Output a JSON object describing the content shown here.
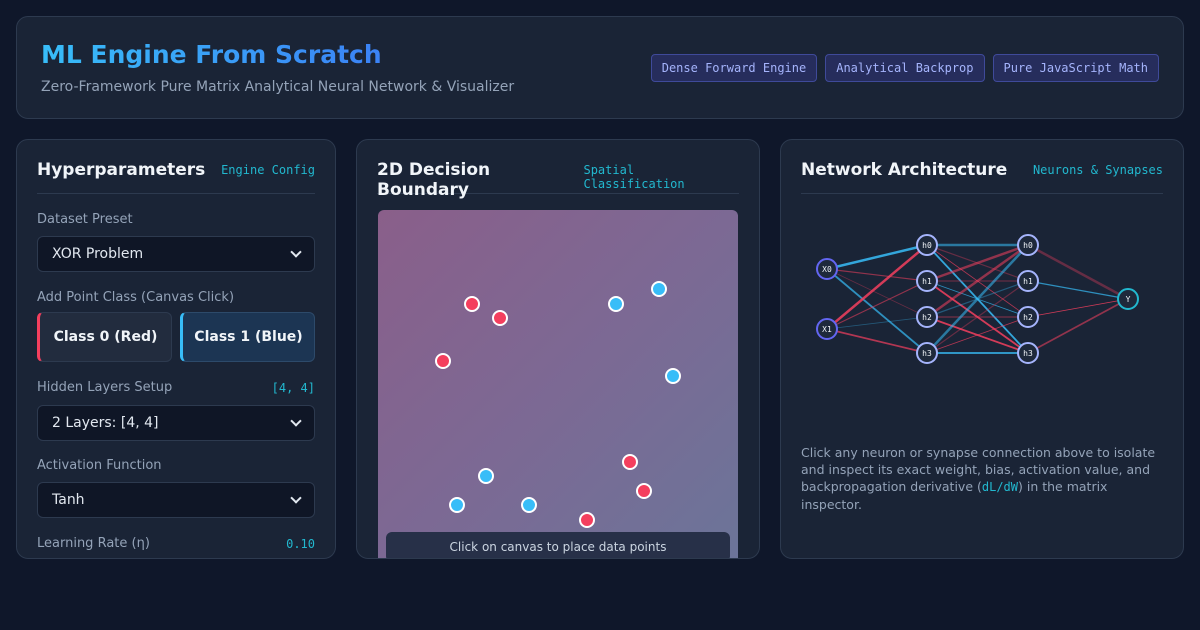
{
  "header": {
    "title": "ML Engine From Scratch",
    "subtitle": "Zero-Framework Pure Matrix Analytical Neural Network & Visualizer",
    "badges": [
      "Dense Forward Engine",
      "Analytical Backprop",
      "Pure JavaScript Math"
    ]
  },
  "hyper": {
    "title": "Hyperparameters",
    "tag": "Engine Config",
    "dataset_label": "Dataset Preset",
    "dataset_value": "XOR Problem",
    "add_point_label": "Add Point Class (Canvas Click)",
    "class0": "Class 0 (Red)",
    "class1": "Class 1 (Blue)",
    "hidden_label": "Hidden Layers Setup",
    "hidden_value": "[4, 4]",
    "hidden_select": "2 Layers: [4, 4]",
    "activation_label": "Activation Function",
    "activation_value": "Tanh",
    "lr_label": "Learning Rate (η)",
    "lr_value": "0.10"
  },
  "boundary": {
    "title": "2D Decision Boundary",
    "tag": "Spatial Classification",
    "hint": "Click on canvas to place data points",
    "points": [
      {
        "cls": 0,
        "x": 0.2,
        "y": 0.8
      },
      {
        "cls": 0,
        "x": 0.3,
        "y": 0.75
      },
      {
        "cls": 0,
        "x": 0.1,
        "y": 0.6
      },
      {
        "cls": 1,
        "x": 0.7,
        "y": 0.8
      },
      {
        "cls": 1,
        "x": 0.85,
        "y": 0.85
      },
      {
        "cls": 1,
        "x": 0.9,
        "y": 0.55
      },
      {
        "cls": 0,
        "x": 0.75,
        "y": 0.25
      },
      {
        "cls": 0,
        "x": 0.8,
        "y": 0.15
      },
      {
        "cls": 1,
        "x": 0.25,
        "y": 0.2
      },
      {
        "cls": 1,
        "x": 0.15,
        "y": 0.1
      },
      {
        "cls": 1,
        "x": 0.4,
        "y": 0.1
      },
      {
        "cls": 0,
        "x": 0.6,
        "y": 0.05
      }
    ]
  },
  "arch": {
    "title": "Network Architecture",
    "tag": "Neurons & Synapses",
    "layers": [
      [
        "X0",
        "X1"
      ],
      [
        "h0",
        "h1",
        "h2",
        "h3"
      ],
      [
        "h0",
        "h1",
        "h2",
        "h3"
      ],
      [
        "Y"
      ]
    ],
    "desc_pre": "Click any neuron or synapse connection above to isolate and inspect its exact weight, bias, activation value, and backpropagation derivative (",
    "desc_code": "dL/dW",
    "desc_post": ") in the matrix inspector."
  },
  "colors": {
    "red": "#f43f5e",
    "blue": "#38bdf8",
    "accent": "#22b8cf"
  }
}
